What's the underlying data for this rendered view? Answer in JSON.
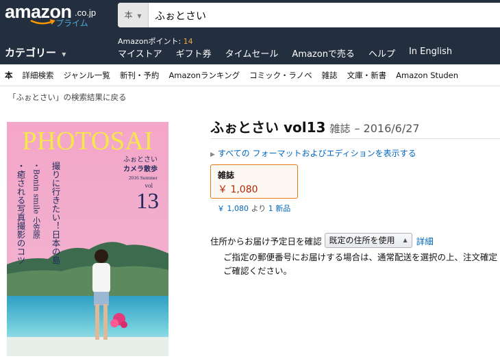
{
  "header": {
    "logo_text": "amazon",
    "logo_suffix": ".co.jp",
    "logo_prime": "プライム",
    "search_category": "本",
    "search_value": "ふぉとさい",
    "category_menu": "カテゴリー",
    "points_label": "Amazonポイント: ",
    "points_value": "14",
    "links": [
      "マイストア",
      "ギフト券",
      "タイムセール",
      "Amazonで売る",
      "ヘルプ",
      "In English"
    ]
  },
  "subnav": [
    "本",
    "詳細検索",
    "ジャンル一覧",
    "新刊・予約",
    "Amazonランキング",
    "コミック・ラノベ",
    "雑誌",
    "文庫・新書",
    "Amazon Studen"
  ],
  "back_link": "「ふぉとさい」の検索結果に戻る",
  "cover": {
    "masthead": "PHOTOSAI",
    "kana_title": "ふぉとさい",
    "series": "カメラ散歩",
    "issue_label": "2016 Summer",
    "vol_label": "vol",
    "vol_number": "13",
    "headline1": "撮りに行きたい！日本の島",
    "headline2": "・Bonin smile 小笠原",
    "headline3": "・癒される写真撮影のコツ"
  },
  "product": {
    "title": "ふぉとさい vol13",
    "format": "雑誌",
    "date": "– 2016/6/27",
    "all_formats_prefix": "すべての",
    "all_formats_link": "フォーマットおよびエディションを表示する",
    "format_box_label": "雑誌",
    "format_box_price": "￥ 1,080",
    "offer_price": "￥ 1,080",
    "offer_mid": " より ",
    "offer_new": "1 新品"
  },
  "shipping": {
    "label": "住所からお届け予定日を確認",
    "select_value": "既定の住所を使用",
    "detail_link": "詳細",
    "notice": "ご指定の郵便番号にお届けする場合は、通常配送を選択の上、注文確定ご確認ください。"
  },
  "colors": {
    "header_bg": "#232f3e",
    "link": "#0066c0",
    "price": "#b12704",
    "accent": "#e47911",
    "points": "#f3a847",
    "cover_pink": "#f2a9cb"
  }
}
